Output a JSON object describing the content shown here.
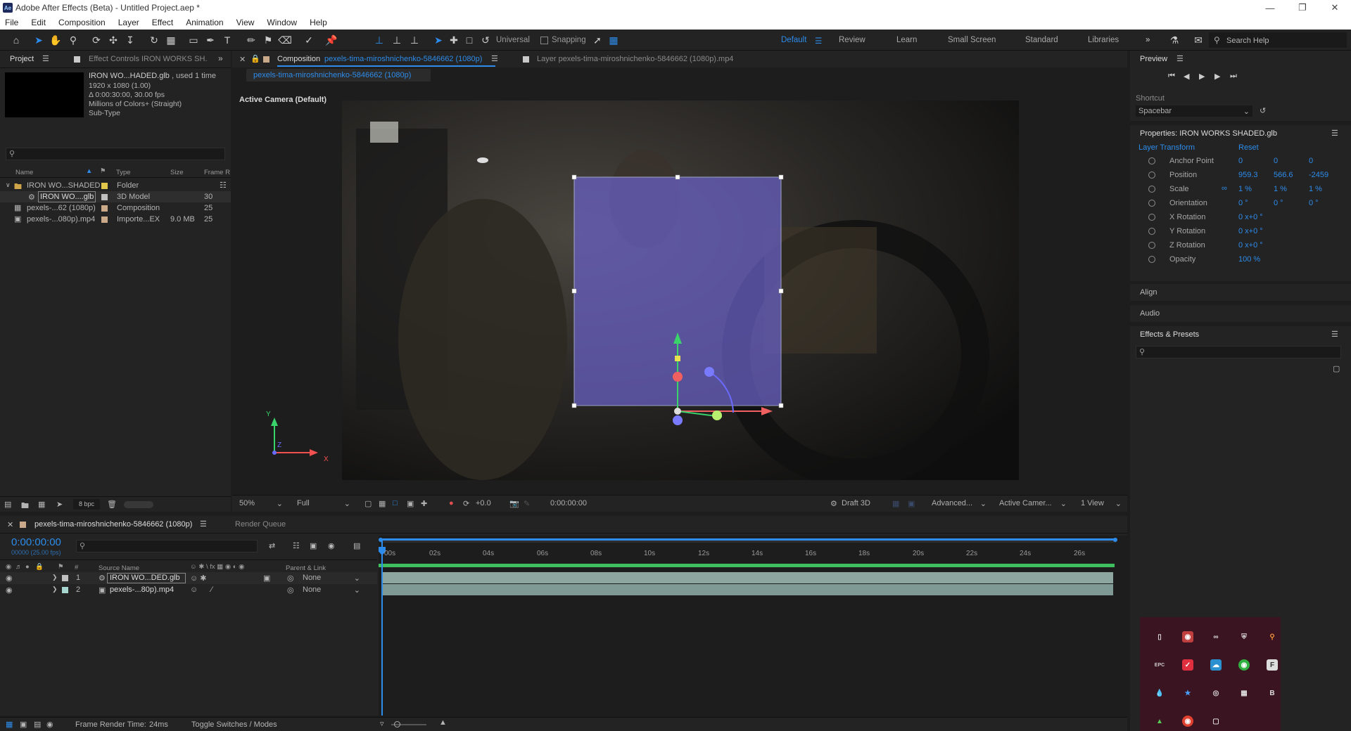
{
  "app": {
    "title": "Adobe After Effects (Beta) - Untitled Project.aep *"
  },
  "menu": [
    "File",
    "Edit",
    "Composition",
    "Layer",
    "Effect",
    "Animation",
    "View",
    "Window",
    "Help"
  ],
  "toolbar": {
    "universal_label": "Universal",
    "snapping_label": "Snapping",
    "workspaces": [
      "Default",
      "Review",
      "Learn",
      "Small Screen",
      "Standard",
      "Libraries"
    ],
    "search_help_placeholder": "Search Help"
  },
  "project_panel": {
    "tab_label": "Project",
    "effect_controls_label": "Effect Controls IRON WORKS SH.",
    "selected_name": "IRON WO...HADED.glb",
    "used_text": ", used 1 time",
    "info_lines": [
      "1920 x 1080 (1.00)",
      "Δ 0:00:30:00, 30.00 fps",
      "Millions of Colors+ (Straight)",
      "Sub-Type"
    ],
    "columns": {
      "name": "Name",
      "type": "Type",
      "size": "Size",
      "frame_rate": "Frame R"
    },
    "items": [
      {
        "name": "IRON WO...SHADED",
        "type": "Folder",
        "size": "",
        "fps": "",
        "color": "#e1c74a"
      },
      {
        "name": "IRON WO....glb",
        "type": "3D Model",
        "size": "",
        "fps": "30",
        "color": "#c0c0c0"
      },
      {
        "name": "pexels-...62 (1080p)",
        "type": "Composition",
        "size": "",
        "fps": "25",
        "color": "#c9a98a"
      },
      {
        "name": "pexels-...080p).mp4",
        "type": "Importe...EX",
        "size": "9.0 MB",
        "fps": "25",
        "color": "#c9a98a"
      }
    ],
    "bpc_label": "8 bpc"
  },
  "composition_panel": {
    "tab_prefix": "Composition",
    "comp_name": "pexels-tima-miroshnichenko-5846662 (1080p)",
    "layer_tab": "Layer pexels-tima-miroshnichenko-5846662 (1080p).mp4",
    "subtab": "pexels-tima-miroshnichenko-5846662 (1080p)",
    "camera_label": "Active Camera (Default)",
    "zoom": "50%",
    "resolution": "Full",
    "exposure": "+0.0",
    "timecode": "0:00:00:00",
    "renderer": "Draft 3D",
    "advanced": "Advanced...",
    "active_camera": "Active Camer...",
    "views": "1 View",
    "axis_labels": {
      "x": "X",
      "y": "Y",
      "z": "Z"
    }
  },
  "preview_panel": {
    "title": "Preview",
    "shortcut_label": "Shortcut",
    "shortcut_value": "Spacebar"
  },
  "properties_panel": {
    "title": "Properties: IRON WORKS SHADED.glb",
    "section": "Layer Transform",
    "reset": "Reset",
    "props": [
      {
        "name": "Anchor Point",
        "values": [
          "0",
          "0",
          "0"
        ]
      },
      {
        "name": "Position",
        "values": [
          "959.3",
          "566.6",
          "-2459"
        ]
      },
      {
        "name": "Scale",
        "values": [
          "1 %",
          "1 %",
          "1 %"
        ]
      },
      {
        "name": "Orientation",
        "values": [
          "0 °",
          "0 °",
          "0 °"
        ]
      },
      {
        "name": "X Rotation",
        "values": [
          "0 x+0 °"
        ]
      },
      {
        "name": "Y Rotation",
        "values": [
          "0 x+0 °"
        ]
      },
      {
        "name": "Z Rotation",
        "values": [
          "0 x+0 °"
        ]
      },
      {
        "name": "Opacity",
        "values": [
          "100 %"
        ]
      }
    ],
    "align": "Align",
    "audio": "Audio",
    "effects_presets": "Effects & Presets"
  },
  "timeline": {
    "comp_tab": "pexels-tima-miroshnichenko-5846662 (1080p)",
    "render_queue": "Render Queue",
    "timecode": "0:00:00:00",
    "fps_text": "00000 (25.00 fps)",
    "col_source": "Source Name",
    "col_parent": "Parent & Link",
    "ticks": [
      "00s",
      "02s",
      "04s",
      "06s",
      "08s",
      "10s",
      "12s",
      "14s",
      "16s",
      "18s",
      "20s",
      "22s",
      "24s",
      "26s"
    ],
    "layers": [
      {
        "num": "1",
        "name": "IRON WO...DED.glb",
        "parent": "None"
      },
      {
        "num": "2",
        "name": "pexels-...80p).mp4",
        "parent": "None"
      }
    ]
  },
  "statusbar": {
    "frame_render_label": "Frame Render Time:",
    "frame_render_value": "24ms",
    "toggle_label": "Toggle Switches / Modes"
  },
  "colors": {
    "accent": "#2d8ceb",
    "bounding_box": "#6a62c8",
    "tray_bg": "#3a1420"
  }
}
